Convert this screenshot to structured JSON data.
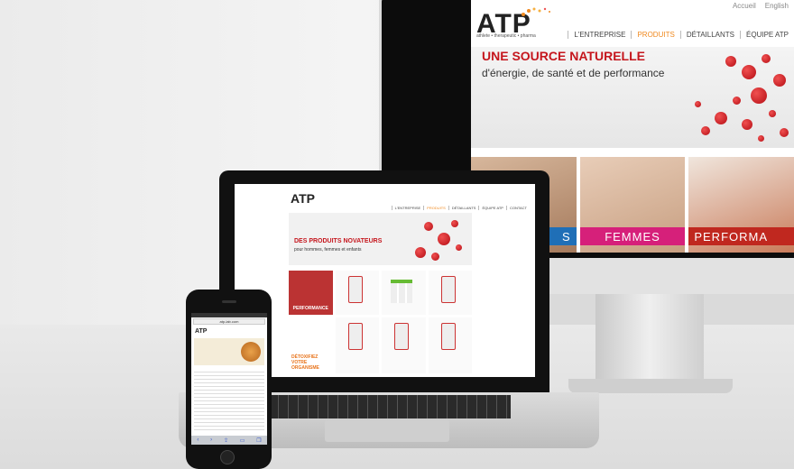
{
  "monitor": {
    "top_links": [
      "Accueil",
      "English"
    ],
    "logo": "ATP",
    "tagline": "athlete • therapeutic • pharma",
    "menu": [
      {
        "label": "L'ENTREPRISE",
        "active": false
      },
      {
        "label": "PRODUITS",
        "active": true
      },
      {
        "label": "DÉTAILLANTS",
        "active": false
      },
      {
        "label": "ÉQUIPE ATP",
        "active": false
      }
    ],
    "headline": "UNE SOURCE NATURELLE",
    "subline": "d'énergie, de santé et de performance",
    "tiles": [
      {
        "label": "S",
        "color": "#1f6fb7"
      },
      {
        "label": "FEMMES",
        "color": "#d6207a"
      },
      {
        "label": "PERFORMA",
        "color": "#c0281f"
      }
    ]
  },
  "laptop": {
    "logo": "ATP",
    "menu": [
      {
        "label": "L'ENTREPRISE",
        "active": false
      },
      {
        "label": "PRODUITS",
        "active": true
      },
      {
        "label": "DÉTAILLANTS",
        "active": false
      },
      {
        "label": "ÉQUIPE ATP",
        "active": false
      },
      {
        "label": "CONTACT",
        "active": false
      }
    ],
    "headline": "DES PRODUITS NOVATEURS",
    "subline": "pour hommes, femmes et enfants",
    "perf_label": "PERFORMANCE",
    "detox_label": "DÉTOXIFIEZ VOTRE ORGANISME"
  },
  "phone": {
    "url": "atp-lab.com",
    "logo": "ATP"
  },
  "colors": {
    "accent_red": "#c5161d",
    "accent_orange": "#f08a20"
  }
}
